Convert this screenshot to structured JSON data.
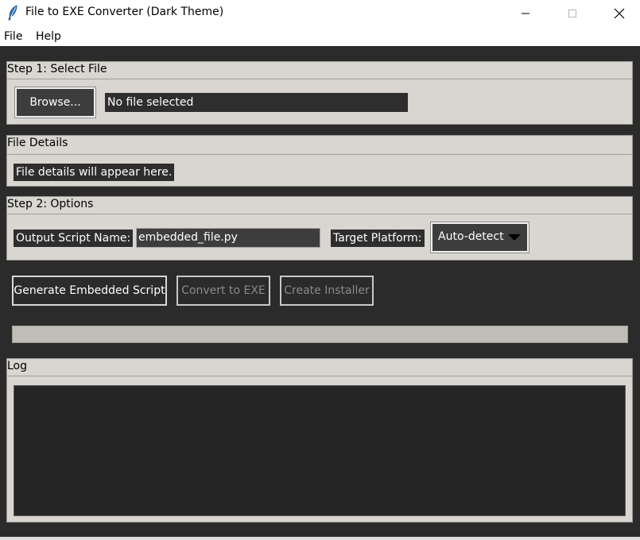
{
  "window": {
    "title": "File to EXE Converter (Dark Theme)",
    "icon": "feather-icon",
    "controls": [
      "minimize-icon",
      "maximize-icon",
      "close-icon"
    ]
  },
  "menu": {
    "items": [
      {
        "label": "File"
      },
      {
        "label": "Help"
      }
    ]
  },
  "step1": {
    "label": "Step 1: Select File",
    "browse_label": "Browse...",
    "file_path": "No file selected"
  },
  "details": {
    "label": "File Details",
    "text": "File details will appear here."
  },
  "step2": {
    "label": "Step 2: Options",
    "output_label": "Output Script Name:",
    "output_value": "embedded_file.py",
    "platform_label": "Target Platform:",
    "platform_value": "Auto-detect"
  },
  "actions": {
    "generate_label": "Generate Embedded Script",
    "convert_label": "Convert to EXE",
    "installer_label": "Create Installer"
  },
  "progress": {
    "value": 0
  },
  "log": {
    "label": "Log",
    "content": ""
  },
  "colors": {
    "background": "#2b2b2b",
    "frame": "#d9d6d1",
    "dark_widget": "#3d3d3d",
    "progress_trough": "#c0bdb6"
  }
}
